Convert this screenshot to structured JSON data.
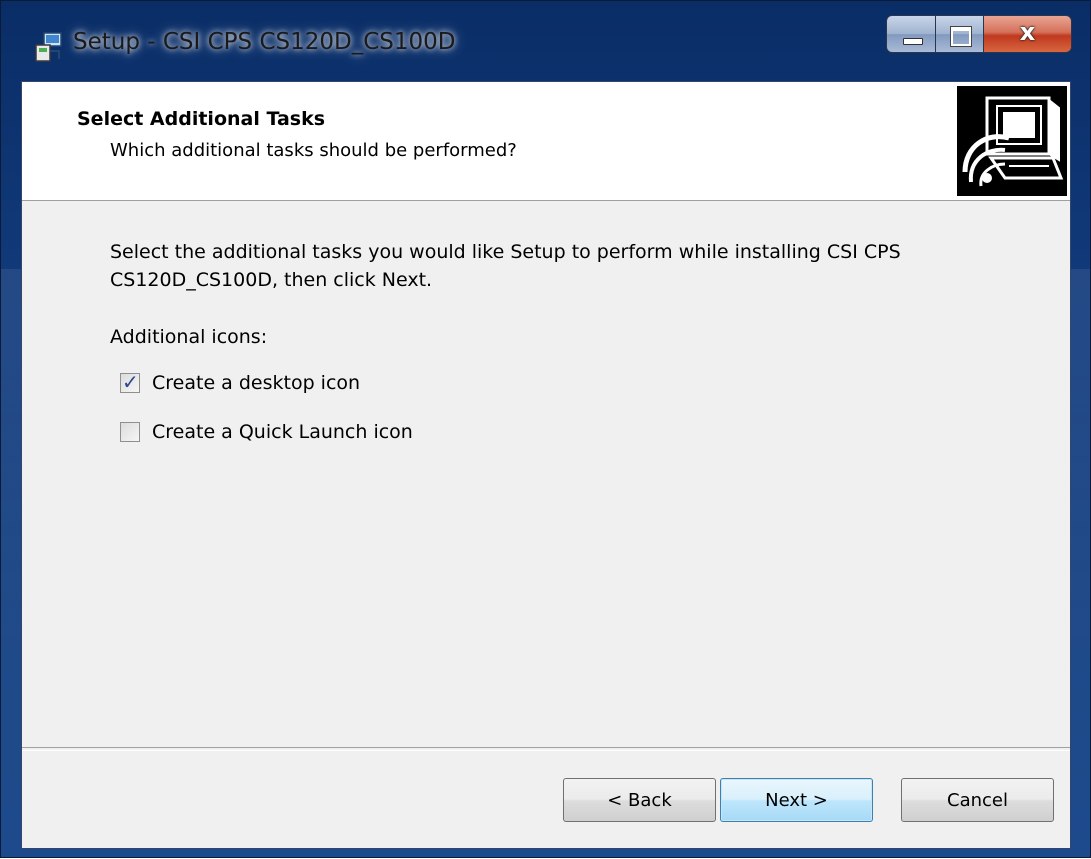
{
  "window": {
    "title": "Setup - CSI CPS CS120D_CS100D",
    "controls": {
      "minimize": "",
      "maximize": "",
      "close": "x"
    }
  },
  "header": {
    "title": "Select Additional Tasks",
    "subtitle": "Which additional tasks should be performed?",
    "image_icon": "computer-setup-icon"
  },
  "content": {
    "intro": "Select the additional tasks you would like Setup to perform while installing CSI CPS CS120D_CS100D, then click Next.",
    "group_label": "Additional icons:",
    "tasks": [
      {
        "label": "Create a desktop icon",
        "checked": true
      },
      {
        "label": "Create a Quick Launch icon",
        "checked": false
      }
    ]
  },
  "buttons": {
    "back": "< Back",
    "next": "Next >",
    "cancel": "Cancel"
  },
  "colors": {
    "frame": "#123b7c",
    "client_bg": "#f0f0f0",
    "header_bg": "#ffffff",
    "close_button": "#c0391f",
    "default_button_border": "#3c7fb1"
  }
}
